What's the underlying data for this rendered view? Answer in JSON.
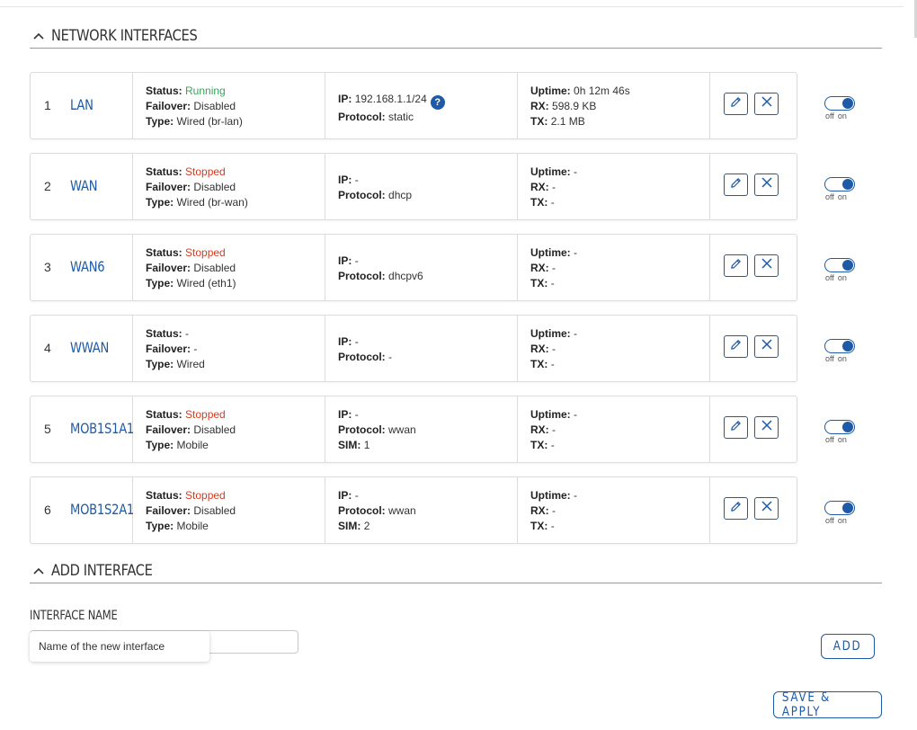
{
  "network_section": {
    "title": "NETWORK INTERFACES"
  },
  "labels": {
    "status": "Status:",
    "failover": "Failover:",
    "type": "Type:",
    "ip": "IP:",
    "protocol": "Protocol:",
    "sim": "SIM:",
    "uptime": "Uptime:",
    "rx": "RX:",
    "tx": "TX:",
    "toggle_off": "off",
    "toggle_on": "on",
    "help_glyph": "?"
  },
  "interfaces": [
    {
      "index": "1",
      "name": "LAN",
      "status": "Running",
      "status_state": "running",
      "failover": "Disabled",
      "type": "Wired (br-lan)",
      "ip": "192.168.1.1/24",
      "protocol": "static",
      "sim": null,
      "uptime": "0h 12m 46s",
      "rx": "598.9 KB",
      "tx": "2.1 MB",
      "enabled": true
    },
    {
      "index": "2",
      "name": "WAN",
      "status": "Stopped",
      "status_state": "stopped",
      "failover": "Disabled",
      "type": "Wired (br-wan)",
      "ip": "-",
      "protocol": "dhcp",
      "sim": null,
      "uptime": "-",
      "rx": "-",
      "tx": "-",
      "enabled": true
    },
    {
      "index": "3",
      "name": "WAN6",
      "status": "Stopped",
      "status_state": "stopped",
      "failover": "Disabled",
      "type": "Wired (eth1)",
      "ip": "-",
      "protocol": "dhcpv6",
      "sim": null,
      "uptime": "-",
      "rx": "-",
      "tx": "-",
      "enabled": true
    },
    {
      "index": "4",
      "name": "WWAN",
      "status": "-",
      "status_state": "none",
      "failover": "-",
      "type": "Wired",
      "ip": "-",
      "protocol": "-",
      "sim": null,
      "uptime": "-",
      "rx": "-",
      "tx": "-",
      "enabled": true
    },
    {
      "index": "5",
      "name": "MOB1S1A1",
      "status": "Stopped",
      "status_state": "stopped",
      "failover": "Disabled",
      "type": "Mobile",
      "ip": "-",
      "protocol": "wwan",
      "sim": "1",
      "uptime": "-",
      "rx": "-",
      "tx": "-",
      "enabled": true
    },
    {
      "index": "6",
      "name": "MOB1S2A1",
      "status": "Stopped",
      "status_state": "stopped",
      "failover": "Disabled",
      "type": "Mobile",
      "ip": "-",
      "protocol": "wwan",
      "sim": "2",
      "uptime": "-",
      "rx": "-",
      "tx": "-",
      "enabled": true
    }
  ],
  "add_section": {
    "title": "ADD INTERFACE",
    "field_label": "INTERFACE NAME",
    "input_value": "",
    "tooltip": "Name of the new interface",
    "add_button": "ADD"
  },
  "footer": {
    "save_apply": "SAVE & APPLY"
  },
  "colors": {
    "accent": "#1e5aa6",
    "running": "#3aa15b",
    "stopped": "#d9391e",
    "border": "#dcdcdc"
  },
  "icons": {
    "collapse": "chevron-up-icon",
    "edit": "pencil-icon",
    "delete": "close-icon",
    "help": "question-icon"
  }
}
